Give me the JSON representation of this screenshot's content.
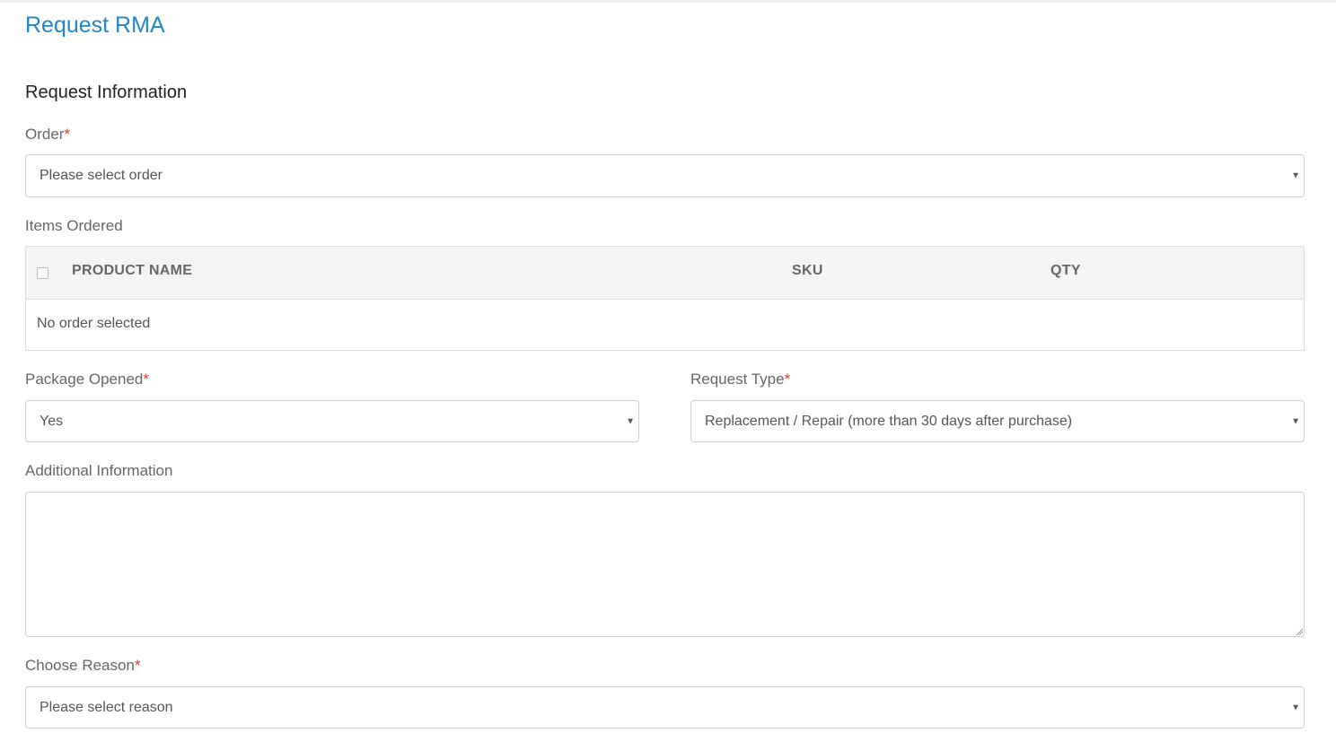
{
  "page": {
    "title": "Request RMA",
    "section_title": "Request Information"
  },
  "order": {
    "label": "Order",
    "required_mark": "*",
    "value": "Please select order"
  },
  "items": {
    "label": "Items Ordered",
    "columns": [
      "PRODUCT NAME",
      "SKU",
      "QTY"
    ],
    "empty_text": "No order selected"
  },
  "package_opened": {
    "label": "Package Opened",
    "required_mark": "*",
    "value": "Yes"
  },
  "request_type": {
    "label": "Request Type",
    "required_mark": "*",
    "value": "Replacement / Repair (more than 30 days after purchase)"
  },
  "additional_info": {
    "label": "Additional Information",
    "value": ""
  },
  "reason": {
    "label": "Choose Reason",
    "required_mark": "*",
    "value": "Please select reason"
  },
  "icons": {
    "caret": "chevron-down-icon",
    "resize": "resize-handle-icon"
  },
  "colors": {
    "title": "#1e88c7",
    "required": "#d9402f"
  }
}
